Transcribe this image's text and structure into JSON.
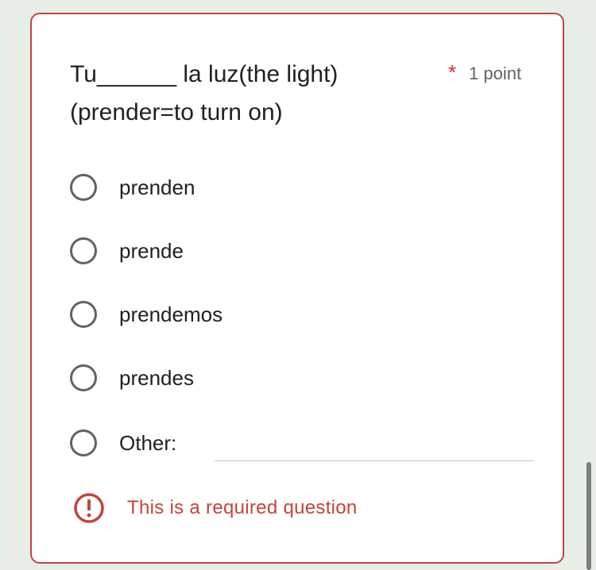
{
  "question": {
    "title_line1": "Tu______ la luz(the light)",
    "title_line2": "(prender=to turn on)",
    "required_marker": "*",
    "points": "1 point"
  },
  "options": [
    {
      "label": "prenden"
    },
    {
      "label": "prende"
    },
    {
      "label": "prendemos"
    },
    {
      "label": "prendes"
    },
    {
      "label": "Other:"
    }
  ],
  "other_input": {
    "value": ""
  },
  "error": {
    "message": "This is a required question",
    "icon": "error-exclamation-icon"
  },
  "colors": {
    "error_red": "#c5443a",
    "radio_gray": "#5f6368",
    "background": "#e8efe6"
  }
}
